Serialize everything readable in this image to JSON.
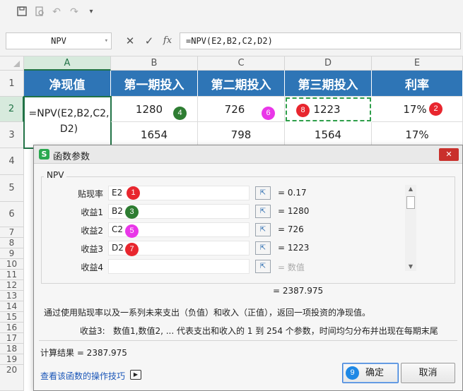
{
  "toolbar": {
    "icons": [
      "save-icon",
      "print-preview-icon",
      "undo-icon",
      "redo-icon",
      "customize-icon"
    ]
  },
  "formula_bar": {
    "name_box": "NPV",
    "cancel": "✕",
    "confirm": "✓",
    "fx": "fx",
    "formula": "=NPV(E2,B2,C2,D2)"
  },
  "grid": {
    "columns": [
      "A",
      "B",
      "C",
      "D",
      "E"
    ],
    "rows": [
      "1",
      "2",
      "3",
      "4",
      "5",
      "6",
      "7",
      "8",
      "9",
      "10",
      "11",
      "12",
      "13",
      "14",
      "15",
      "16",
      "17",
      "18",
      "19",
      "20"
    ],
    "headers": [
      "净现值",
      "第一期投入",
      "第二期投入",
      "第三期投入",
      "利率"
    ],
    "row2": {
      "a_line1": "=NPV(E2,B2,C2,",
      "a_line2": "D2)",
      "b": "1280",
      "c": "726",
      "d": "1223",
      "e": "17%"
    },
    "row3": {
      "b": "1654",
      "c": "798",
      "d": "1564",
      "e": "17%"
    }
  },
  "badges": {
    "b1": "1",
    "b2": "2",
    "b3": "3",
    "b4": "4",
    "b5": "5",
    "b6": "6",
    "b7": "7",
    "b8": "8",
    "b9": "9"
  },
  "dialog": {
    "title": "函数参数",
    "close": "✕",
    "function_name": "NPV",
    "args": [
      {
        "label": "贴现率",
        "value": "E2",
        "result": "=  0.17"
      },
      {
        "label": "收益1",
        "value": "B2",
        "result": "=  1280"
      },
      {
        "label": "收益2",
        "value": "C2",
        "result": "=  726"
      },
      {
        "label": "收益3",
        "value": "D2",
        "result": "=  1223"
      },
      {
        "label": "收益4",
        "value": "",
        "result": "=  数值"
      }
    ],
    "formula_result": "=  2387.975",
    "description": "通过使用贴现率以及一系列未来支出（负值）和收入（正值），返回一项投资的净现值。",
    "arg_help_label": "收益3:",
    "arg_help": "数值1,数值2, ... 代表支出和收入的 1 到 254 个参数，时间均匀分布并出现在每期末尾",
    "calc_result": "计算结果  =  2387.975",
    "help_link": "查看该函数的操作技巧",
    "ok": "确定",
    "cancel": "取消"
  },
  "colors": {
    "header_fill": "#2e75b6",
    "selection": "#217346",
    "badge_red": "#e8262e",
    "badge_green": "#2e7d32",
    "badge_pink": "#e936e8",
    "badge_blue": "#1e88e5"
  }
}
